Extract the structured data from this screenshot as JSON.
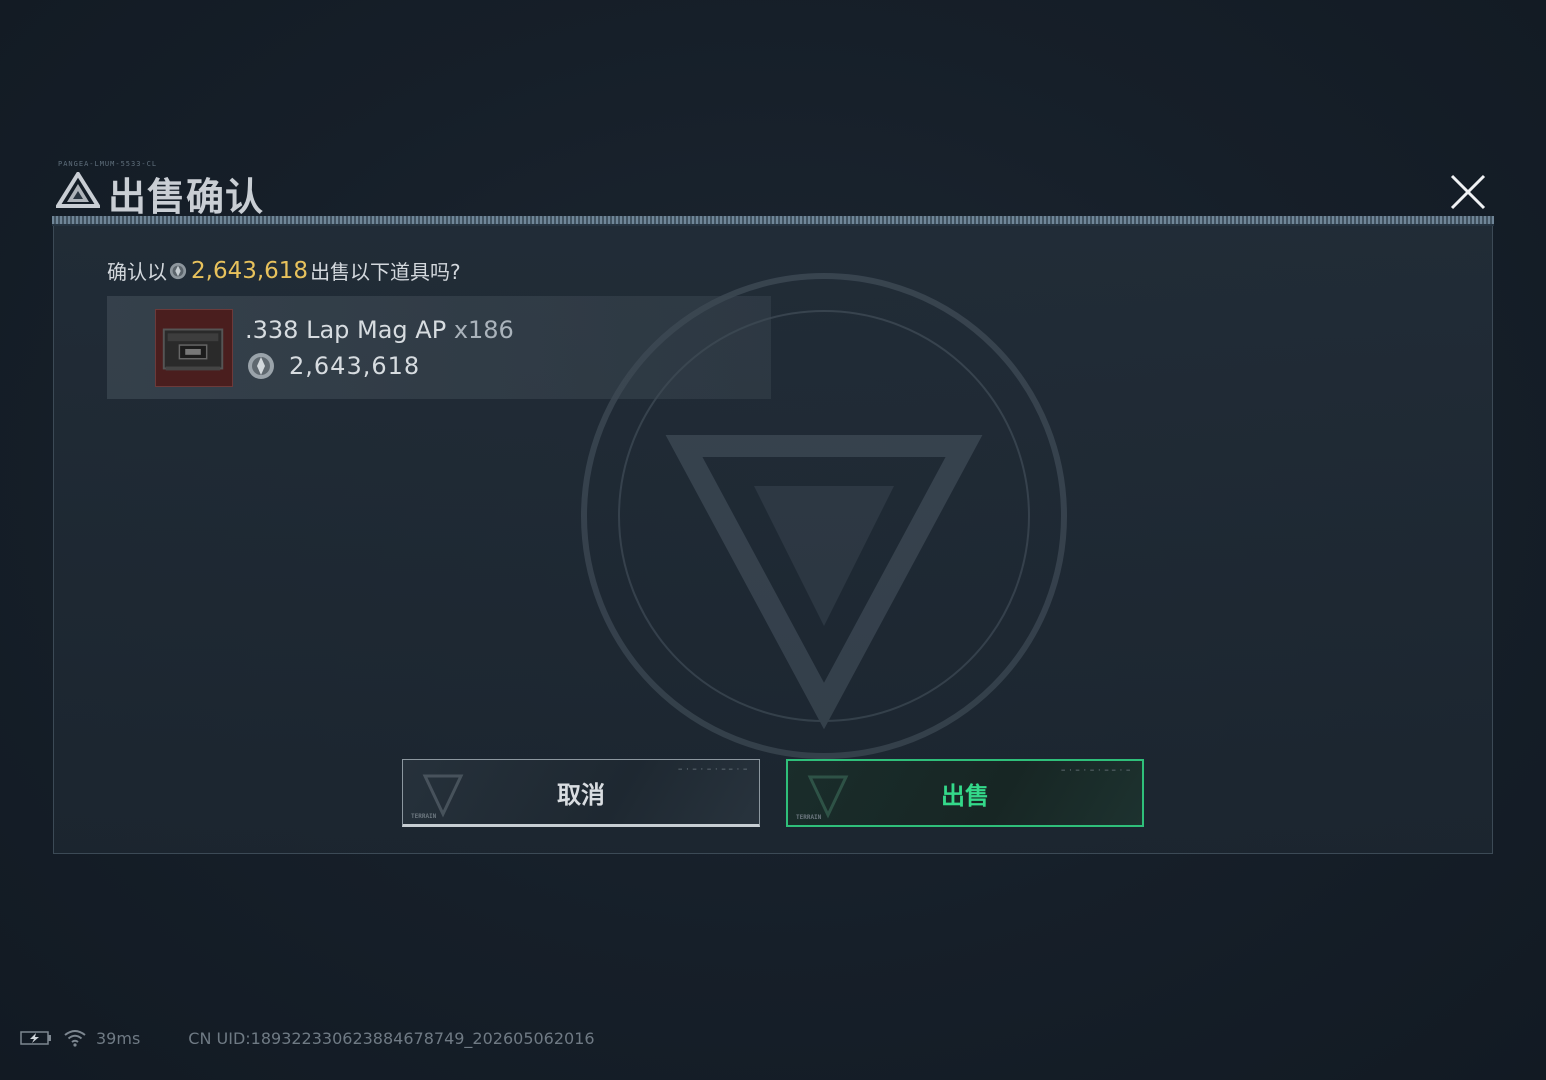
{
  "dialog": {
    "header_tag": "PANGEA-LMUM-5533-CL",
    "title": "出售确认",
    "close_icon": "close-x-icon"
  },
  "confirm": {
    "prefix": "确认以",
    "amount": "2,643,618",
    "suffix": "出售以下道具吗?"
  },
  "item": {
    "name": ".338 Lap Mag AP ",
    "quantity": "x186",
    "price": "2,643,618",
    "thumbnail_icon": "ammo-box-icon",
    "currency_icon": "coin-icon"
  },
  "buttons": {
    "cancel_label": "取消",
    "sell_label": "出售",
    "deco_code": "— · — · —  ·  — — · —",
    "deco_small": "TERRAIN"
  },
  "status": {
    "ping": "39ms",
    "uid": "CN UID:18932233062388467874​9_202605062016"
  },
  "colors": {
    "accent_gold": "#e8c25c",
    "accent_green": "#34d98a",
    "panel_bg": "#1c2630"
  }
}
